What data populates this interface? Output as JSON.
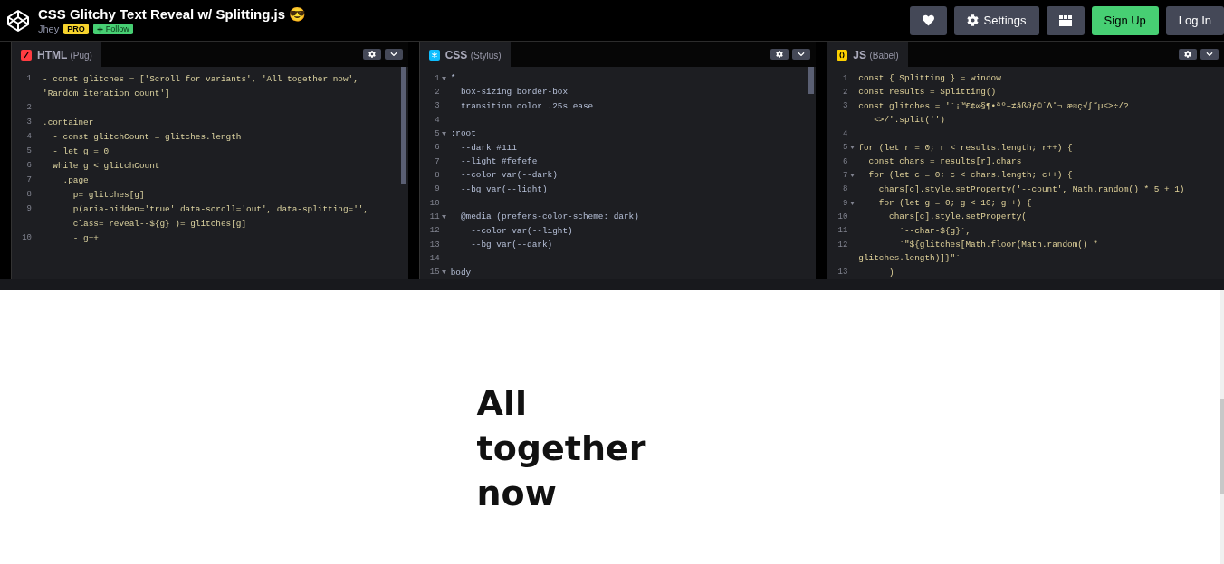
{
  "header": {
    "title": "CSS Glitchy Text Reveal w/ Splitting.js 😎",
    "author": "Jhey",
    "badge": "PRO",
    "follow": "Follow",
    "buttons": [
      {
        "kind": "heart"
      },
      {
        "kind": "settings",
        "label": "Settings"
      },
      {
        "kind": "layout"
      },
      {
        "kind": "signup",
        "label": "Sign Up"
      },
      {
        "kind": "login",
        "label": "Log In"
      }
    ]
  },
  "editors": [
    {
      "kind": "html",
      "name": "HTML",
      "preprocessor": "(Pug)",
      "lines": [
        {
          "num": "1",
          "text": "- const glitches = ['Scroll for variants', 'All together now',",
          "fold": false
        },
        {
          "text": "'Random iteration count']",
          "fold": false
        },
        {
          "num": "2",
          "fold": false
        },
        {
          "num": "3",
          "text": ".container",
          "fold": false
        },
        {
          "num": "4",
          "text": "  - const glitchCount = glitches.length",
          "fold": false
        },
        {
          "num": "5",
          "text": "  - let g = 0",
          "fold": false
        },
        {
          "num": "6",
          "text": "  while g < glitchCount",
          "fold": false
        },
        {
          "num": "7",
          "text": "    .page",
          "fold": false
        },
        {
          "num": "8",
          "text": "      p= glitches[g]",
          "fold": false
        },
        {
          "num": "9",
          "text": "      p(aria-hidden='true' data-scroll='out', data-splitting='',",
          "fold": false
        },
        {
          "text": "      class=`reveal--${g}`)= glitches[g]",
          "fold": false
        },
        {
          "num": "10",
          "text": "      - g++",
          "fold": false
        }
      ]
    },
    {
      "kind": "css",
      "name": "CSS",
      "preprocessor": "(Stylus)",
      "lines": [
        {
          "num": "1",
          "text": "*",
          "fold": true
        },
        {
          "num": "2",
          "text": "  box-sizing border-box",
          "fold": false
        },
        {
          "num": "3",
          "text": "  transition color .25s ease",
          "fold": false
        },
        {
          "num": "4",
          "fold": false
        },
        {
          "num": "5",
          "text": ":root",
          "fold": true
        },
        {
          "num": "6",
          "text": "  --dark #111",
          "fold": false
        },
        {
          "num": "7",
          "text": "  --light #fefefe",
          "fold": false
        },
        {
          "num": "8",
          "text": "  --color var(--dark)",
          "fold": false
        },
        {
          "num": "9",
          "text": "  --bg var(--light)",
          "fold": false
        },
        {
          "num": "10",
          "fold": false
        },
        {
          "num": "11",
          "text": "  @media (prefers-color-scheme: dark)",
          "fold": true
        },
        {
          "num": "12",
          "text": "    --color var(--light)",
          "fold": false
        },
        {
          "num": "13",
          "text": "    --bg var(--dark)",
          "fold": false
        },
        {
          "num": "14",
          "fold": false
        },
        {
          "num": "15",
          "text": "body",
          "fold": true
        }
      ]
    },
    {
      "kind": "js",
      "name": "JS",
      "preprocessor": "(Babel)",
      "lines": [
        {
          "num": "1",
          "text": "const { Splitting } = window",
          "fold": false
        },
        {
          "num": "2",
          "text": "const results = Splitting()",
          "fold": false
        },
        {
          "num": "3",
          "text": "const glitches = '`¡™£¢∞§¶•ªº–≠åß∂ƒ©˙∆˚¬…æ≈ç√∫˜µ≤≥÷/?",
          "fold": false
        },
        {
          "text": "   <>/'.split('')",
          "fold": false
        },
        {
          "num": "4",
          "fold": false
        },
        {
          "num": "5",
          "text": "for (let r = 0; r < results.length; r++) {",
          "fold": true
        },
        {
          "num": "6",
          "text": "  const chars = results[r].chars",
          "fold": false
        },
        {
          "num": "7",
          "text": "  for (let c = 0; c < chars.length; c++) {",
          "fold": true
        },
        {
          "num": "8",
          "text": "    chars[c].style.setProperty('--count', Math.random() * 5 + 1)",
          "fold": false
        },
        {
          "num": "9",
          "text": "    for (let g = 0; g < 10; g++) {",
          "fold": true
        },
        {
          "num": "10",
          "text": "      chars[c].style.setProperty(",
          "fold": false
        },
        {
          "num": "11",
          "text": "        `--char-${g}`,",
          "fold": false
        },
        {
          "num": "12",
          "text": "        `\"${glitches[Math.floor(Math.random() *",
          "fold": false
        },
        {
          "text": "glitches.length)]}\"`",
          "fold": false
        },
        {
          "num": "13",
          "text": "      )",
          "fold": false
        }
      ]
    }
  ],
  "preview": {
    "heading": "All together now"
  }
}
